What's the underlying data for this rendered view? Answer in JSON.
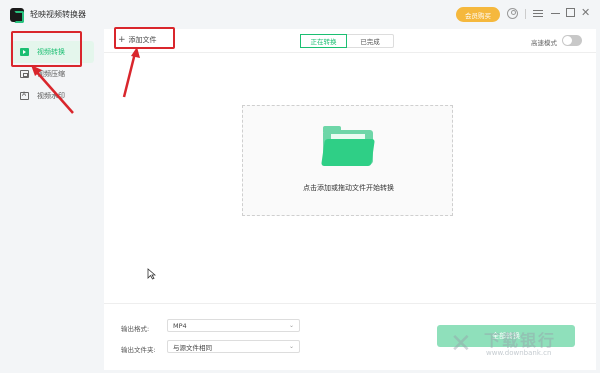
{
  "app": {
    "title": "轻映视频转换器"
  },
  "titlebar": {
    "vip_label": "会员购买",
    "close_glyph": "✕"
  },
  "sidebar": {
    "items": [
      {
        "label": "视频转换",
        "icon": "video-convert-icon",
        "active": true
      },
      {
        "label": "视频压缩",
        "icon": "video-compress-icon",
        "active": false
      },
      {
        "label": "视频水印",
        "icon": "watermark-icon",
        "active": false
      }
    ]
  },
  "toolbar": {
    "add_file_label": "添加文件",
    "tabs": [
      {
        "label": "正在转换",
        "active": true
      },
      {
        "label": "已完成",
        "active": false
      }
    ],
    "speed_mode_label": "高速模式",
    "speed_mode_on": false
  },
  "dropzone": {
    "hint": "点击添加或拖动文件开始转换"
  },
  "bottom": {
    "format_label": "输出格式:",
    "format_value": "MP4",
    "folder_label": "输出文件夹:",
    "folder_value": "与源文件相同",
    "start_label": "全部转换"
  },
  "watermark": {
    "main": "下载银行",
    "sub": "www.downbank.cn"
  },
  "colors": {
    "accent": "#1bbf72",
    "vip": "#f5b83d",
    "annotation": "#d9262c"
  }
}
